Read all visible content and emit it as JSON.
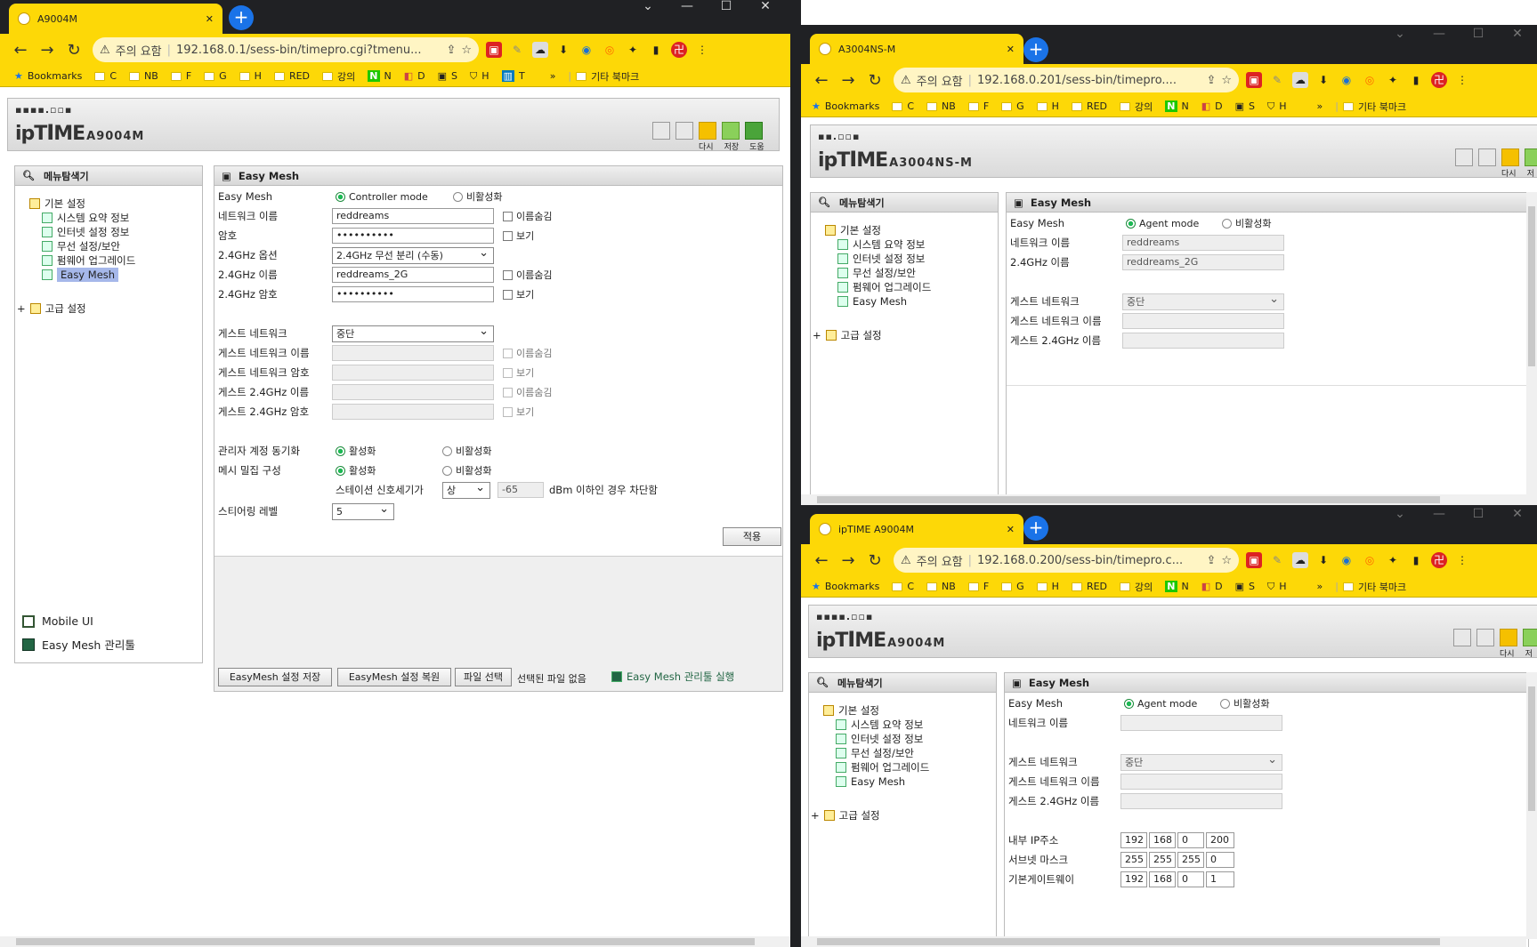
{
  "bookmarks": {
    "label": "Bookmarks",
    "items": [
      "C",
      "NB",
      "F",
      "G",
      "H",
      "RED",
      "강의",
      "N",
      "D",
      "S",
      "H",
      "T"
    ],
    "more": "»",
    "other": "기타 북마크"
  },
  "warning": "주의 요함",
  "w1": {
    "tab_title": "A9004M",
    "url": "192.168.0.1/sess-bin/timepro.cgi?tmenu...",
    "model": "A9004M",
    "hdr_btns": [
      "다시",
      "저장",
      "도움"
    ],
    "menu_title": "메뉴탐색기",
    "tree_root": "기본 설정",
    "tree_items": [
      "시스템 요약 정보",
      "인터넷 설정 정보",
      "무선 설정/보안",
      "펌웨어 업그레이드",
      "Easy Mesh"
    ],
    "tree_adv": "고급 설정",
    "mobile_ui": "Mobile UI",
    "mesh_tool": "Easy Mesh 관리툴",
    "panel_title": "Easy Mesh",
    "labels": {
      "easymesh": "Easy Mesh",
      "netname": "네트워크 이름",
      "pw": "암호",
      "band_opt": "2.4GHz 옵션",
      "name24": "2.4GHz 이름",
      "pw24": "2.4GHz 암호",
      "guest": "게스트 네트워크",
      "guest_name": "게스트 네트워크 이름",
      "guest_pw": "게스트 네트워크 암호",
      "guest24_name": "게스트 2.4GHz 이름",
      "guest24_pw": "게스트 2.4GHz 암호",
      "admin_sync": "관리자 계정 동기화",
      "mesh_dense": "메시 밀집 구성",
      "station": "스테이션 신호세기가",
      "steer": "스티어링 레벨"
    },
    "mode_on": "Controller mode",
    "mode_off": "비활성화",
    "netname": "reddreams",
    "pw": "••••••••••",
    "band_opt": "2.4GHz 무선 분리 (수동)",
    "name24": "reddreams_2G",
    "pw24": "••••••••••",
    "hide": "이름숨김",
    "show": "보기",
    "guest": "중단",
    "on": "활성화",
    "off": "비활성화",
    "signal_sel": "상",
    "signal_val": "-65",
    "signal_suffix": "dBm 이하인 경우 차단함",
    "steer_val": "5",
    "apply": "적용",
    "save_btn": "EasyMesh 설정 저장",
    "restore_btn": "EasyMesh 설정 복원",
    "file_btn": "파일 선택",
    "no_file": "선택된 파일 없음",
    "run_tool": "Easy Mesh 관리툴 실행"
  },
  "w2": {
    "tab_title": "A3004NS-M",
    "url": "192.168.0.201/sess-bin/timepro....",
    "model": "A3004NS-M",
    "hdr_btns": [
      "다시",
      "저"
    ],
    "menu_title": "메뉴탐색기",
    "tree_root": "기본 설정",
    "tree_items": [
      "시스템 요약 정보",
      "인터넷 설정 정보",
      "무선 설정/보안",
      "펌웨어 업그레이드",
      "Easy Mesh"
    ],
    "tree_adv": "고급 설정",
    "panel_title": "Easy Mesh",
    "labels": {
      "easymesh": "Easy Mesh",
      "netname": "네트워크 이름",
      "name24": "2.4GHz 이름",
      "guest": "게스트 네트워크",
      "guest_name": "게스트 네트워크 이름",
      "guest24_name": "게스트 2.4GHz 이름"
    },
    "mode_on": "Agent mode",
    "mode_off": "비활성화",
    "netname": "reddreams",
    "name24": "reddreams_2G",
    "guest": "중단"
  },
  "w3": {
    "tab_title": "ipTIME A9004M",
    "url": "192.168.0.200/sess-bin/timepro.c...",
    "model": "A9004M",
    "hdr_btns": [
      "다시",
      "저"
    ],
    "menu_title": "메뉴탐색기",
    "tree_root": "기본 설정",
    "tree_items": [
      "시스템 요약 정보",
      "인터넷 설정 정보",
      "무선 설정/보안",
      "펌웨어 업그레이드",
      "Easy Mesh"
    ],
    "tree_adv": "고급 설정",
    "panel_title": "Easy Mesh",
    "labels": {
      "easymesh": "Easy Mesh",
      "netname": "네트워크 이름",
      "guest": "게스트 네트워크",
      "guest_name": "게스트 네트워크 이름",
      "guest24_name": "게스트 2.4GHz 이름",
      "ip": "내부 IP주소",
      "mask": "서브넷 마스크",
      "gw": "기본게이트웨이"
    },
    "mode_on": "Agent mode",
    "mode_off": "비활성화",
    "guest": "중단",
    "ip": [
      "192",
      "168",
      "0",
      "200"
    ],
    "mask": [
      "255",
      "255",
      "255",
      "0"
    ],
    "gw": [
      "192",
      "168",
      "0",
      "1"
    ]
  }
}
